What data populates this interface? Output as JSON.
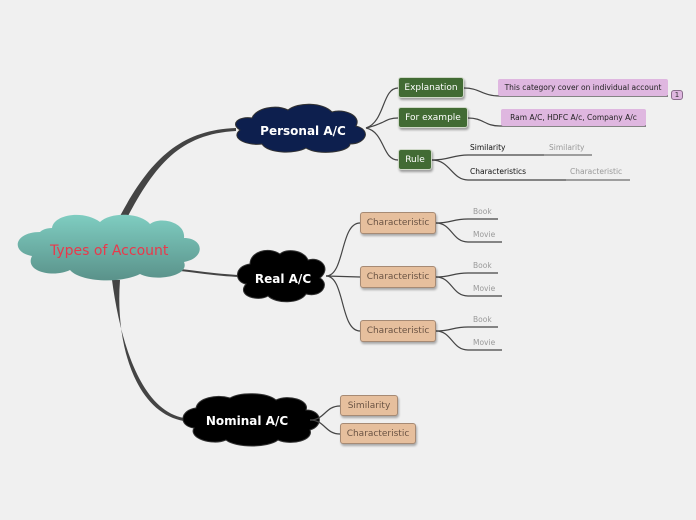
{
  "root": {
    "label": "Types of Account"
  },
  "branches": {
    "personal": {
      "label": "Personal A/C",
      "children": {
        "explanation": {
          "label": "Explanation",
          "note": "This category cover on individual account",
          "note_badge": "1"
        },
        "example": {
          "label": "For example",
          "note": "Ram A/C, HDFC A/c, Company A/c"
        },
        "rule": {
          "label": "Rule",
          "items": [
            {
              "label": "Similarity",
              "sub": "Similarity"
            },
            {
              "label": "Characteristics",
              "sub": "Characteristic"
            }
          ]
        }
      }
    },
    "real": {
      "label": "Real A/C",
      "children": [
        {
          "label": "Characteristic",
          "leaves": [
            "Book",
            "Movie"
          ]
        },
        {
          "label": "Characteristic",
          "leaves": [
            "Book",
            "Movie"
          ]
        },
        {
          "label": "Characteristic",
          "leaves": [
            "Book",
            "Movie"
          ]
        }
      ]
    },
    "nominal": {
      "label": "Nominal A/C",
      "children": [
        {
          "label": "Similarity"
        },
        {
          "label": "Characteristic"
        }
      ]
    }
  },
  "colors": {
    "background": "#f0f0f0",
    "root_fill_top": "#7ecbbf",
    "root_fill_bottom": "#5e978f",
    "root_text": "#e8394b",
    "personal_fill": "#0d1f4e",
    "real_fill": "#000000",
    "nominal_fill": "#000000",
    "green_topic": "#426b34",
    "orange_topic": "#e6bf9d",
    "purple_note": "#dfb7e0",
    "connector": "#444444"
  }
}
